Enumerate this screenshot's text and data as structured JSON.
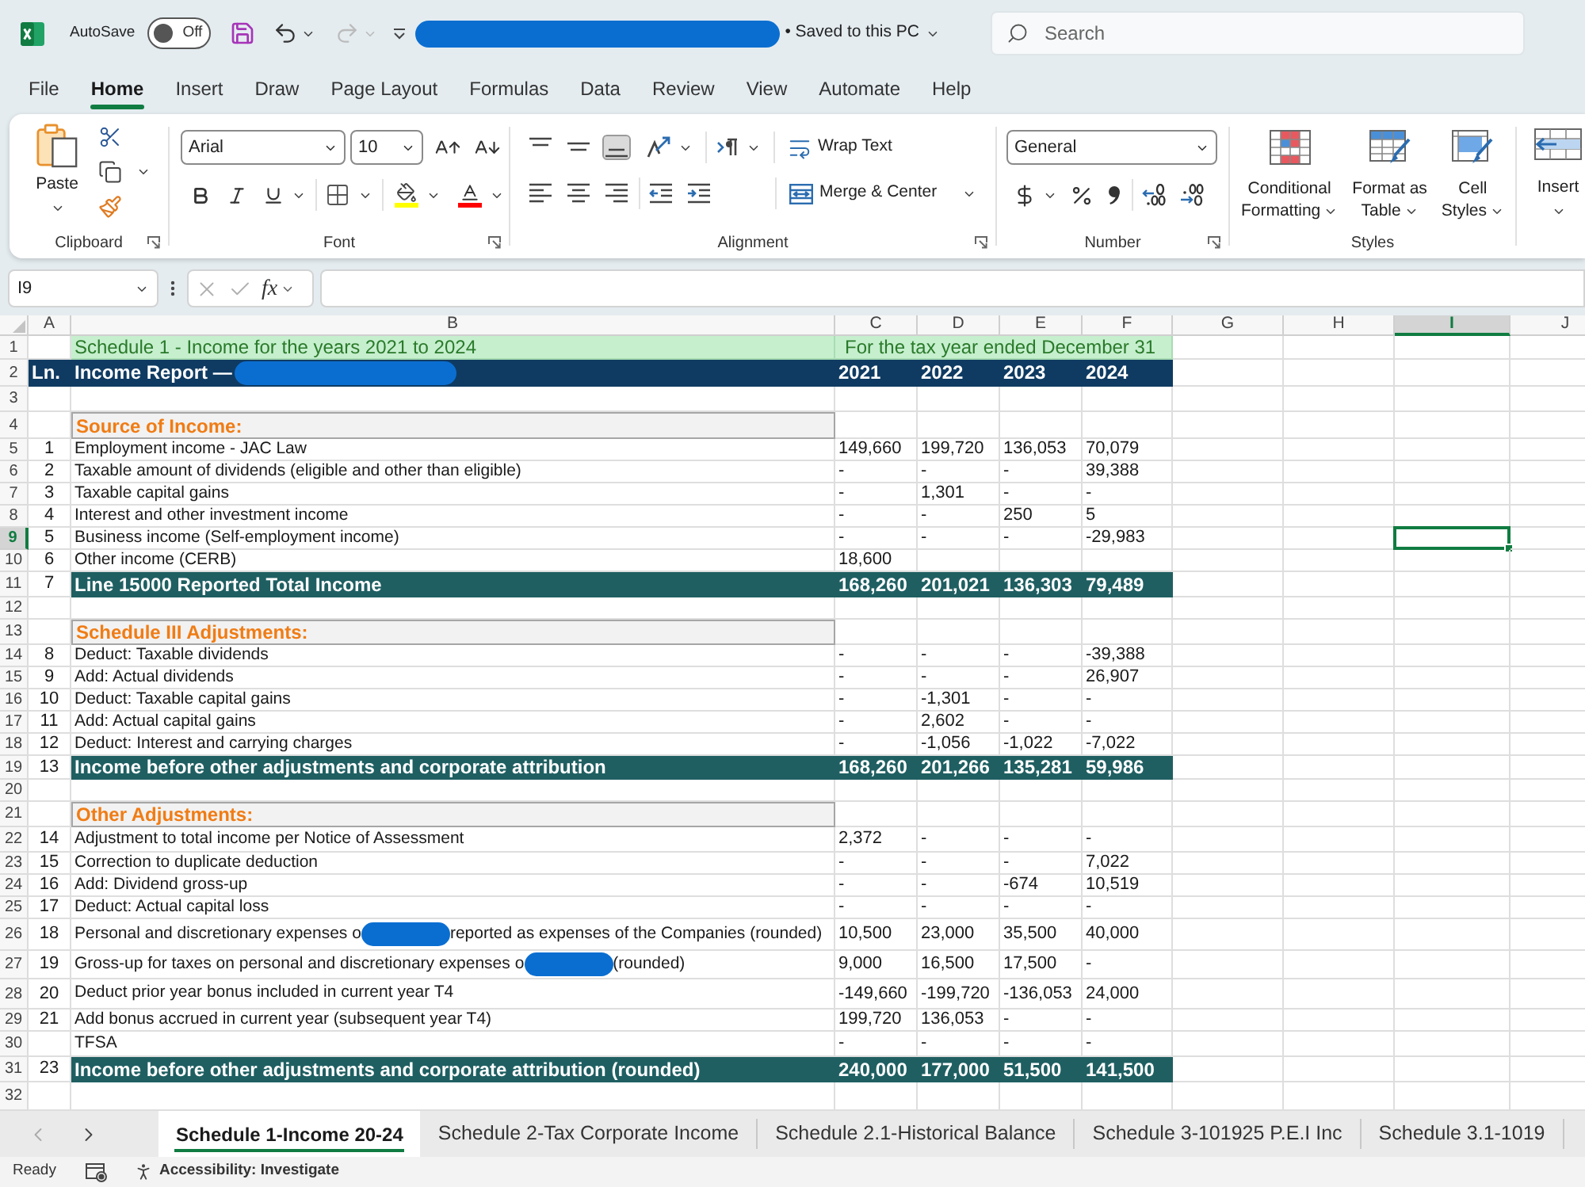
{
  "title_bar": {
    "autosave": {
      "label": "AutoSave",
      "on": false,
      "state_text": "Off"
    },
    "document": [
      {
        "kind": "redaction"
      },
      {
        "kind": "text",
        "text": "• Saved to this PC"
      }
    ],
    "search": {
      "placeholder": "Search"
    }
  },
  "menu": [
    {
      "label": "File",
      "selected": false
    },
    {
      "label": "Home",
      "selected": true
    },
    {
      "label": "Insert",
      "selected": false
    },
    {
      "label": "Draw",
      "selected": false
    },
    {
      "label": "Page Layout",
      "selected": false
    },
    {
      "label": "Formulas",
      "selected": false
    },
    {
      "label": "Data",
      "selected": false
    },
    {
      "label": "Review",
      "selected": false
    },
    {
      "label": "View",
      "selected": false
    },
    {
      "label": "Automate",
      "selected": false
    },
    {
      "label": "Help",
      "selected": false
    }
  ],
  "ribbon": {
    "clipboard": {
      "paste": "Paste",
      "title": "Clipboard"
    },
    "font": {
      "font_name": "Arial",
      "font_size": "10",
      "title": "Font"
    },
    "alignment": {
      "vertical": [
        {
          "kind": "top",
          "selected": false
        },
        {
          "kind": "middle",
          "selected": false
        },
        {
          "kind": "bottom",
          "selected": true
        }
      ],
      "wrap_text": "Wrap Text",
      "merge": "Merge & Center",
      "title": "Alignment"
    },
    "number": {
      "format": "General",
      "title": "Number"
    },
    "styles": {
      "buttons": [
        {
          "kind": "conditional",
          "lines": [
            "Conditional",
            "Formatting"
          ]
        },
        {
          "kind": "table",
          "lines": [
            "Format as",
            "Table"
          ]
        },
        {
          "kind": "cell",
          "lines": [
            "Cell",
            "Styles"
          ]
        }
      ],
      "title": "Styles"
    },
    "cells": {
      "insert": "Insert"
    }
  },
  "formula_bar": {
    "name_box": "I9",
    "function_label": "fx"
  },
  "sheet": {
    "columns": [
      {
        "label": "A",
        "selected": false
      },
      {
        "label": "B",
        "selected": false
      },
      {
        "label": "C",
        "selected": false
      },
      {
        "label": "D",
        "selected": false
      },
      {
        "label": "E",
        "selected": false
      },
      {
        "label": "F",
        "selected": false
      },
      {
        "label": "G",
        "selected": false
      },
      {
        "label": "H",
        "selected": false
      },
      {
        "label": "I",
        "selected": true
      },
      {
        "label": "J",
        "selected": false
      }
    ],
    "rows": [
      {
        "number": "1",
        "selected": false,
        "kind": "title",
        "label": "Schedule 1 - Income for the years 2021 to 2024",
        "period": "For the tax year ended December 31"
      },
      {
        "number": "2",
        "selected": false,
        "kind": "header",
        "line": "Ln.",
        "label_segments": [
          {
            "kind": "text",
            "text": "Income Report —"
          },
          {
            "kind": "redaction"
          }
        ],
        "values": [
          "2021",
          "2022",
          "2023",
          "2024"
        ]
      },
      {
        "number": "3",
        "selected": false,
        "kind": "blank"
      },
      {
        "number": "4",
        "selected": false,
        "kind": "section",
        "label": "Source of Income:"
      },
      {
        "number": "5",
        "selected": false,
        "kind": "item",
        "line": "1",
        "label": "Employment income - JAC Law",
        "values": [
          "149,660",
          "199,720",
          "136,053",
          "70,079"
        ]
      },
      {
        "number": "6",
        "selected": false,
        "kind": "item",
        "line": "2",
        "label": "Taxable amount of dividends (eligible and other than eligible)",
        "values": [
          "-",
          "-",
          "-",
          "39,388"
        ]
      },
      {
        "number": "7",
        "selected": false,
        "kind": "item",
        "line": "3",
        "label": "Taxable capital gains",
        "values": [
          "-",
          "1,301",
          "-",
          "-"
        ]
      },
      {
        "number": "8",
        "selected": false,
        "kind": "item",
        "line": "4",
        "label": "Interest and other investment income",
        "values": [
          "-",
          "-",
          "250",
          "5"
        ]
      },
      {
        "number": "9",
        "selected": true,
        "kind": "item",
        "line": "5",
        "label": "Business income (Self-employment income)",
        "values": [
          "-",
          "-",
          "-",
          "-29,983"
        ]
      },
      {
        "number": "10",
        "selected": false,
        "kind": "item",
        "line": "6",
        "label": "Other income (CERB)",
        "values": [
          "18,600"
        ]
      },
      {
        "number": "11",
        "selected": false,
        "kind": "total",
        "line": "7",
        "label": "Line 15000 Reported Total Income",
        "values": [
          "168,260",
          "201,021",
          "136,303",
          "79,489"
        ]
      },
      {
        "number": "12",
        "selected": false,
        "kind": "blank"
      },
      {
        "number": "13",
        "selected": false,
        "kind": "section",
        "label": "Schedule III Adjustments:"
      },
      {
        "number": "14",
        "selected": false,
        "kind": "item",
        "line": "8",
        "label": "Deduct: Taxable dividends",
        "values": [
          "-",
          "-",
          "-",
          "-39,388"
        ]
      },
      {
        "number": "15",
        "selected": false,
        "kind": "item",
        "line": "9",
        "label": "Add: Actual dividends",
        "values": [
          "-",
          "-",
          "-",
          "26,907"
        ]
      },
      {
        "number": "16",
        "selected": false,
        "kind": "item",
        "line": "10",
        "label": "Deduct: Taxable capital gains",
        "values": [
          "-",
          "-1,301",
          "-",
          "-"
        ]
      },
      {
        "number": "17",
        "selected": false,
        "kind": "item",
        "line": "11",
        "label": "Add: Actual capital gains",
        "values": [
          "-",
          "2,602",
          "-",
          "-"
        ]
      },
      {
        "number": "18",
        "selected": false,
        "kind": "item",
        "line": "12",
        "label": "Deduct: Interest and carrying charges",
        "values": [
          "-",
          "-1,056",
          "-1,022",
          "-7,022"
        ]
      },
      {
        "number": "19",
        "selected": false,
        "kind": "total",
        "line": "13",
        "label": "Income before other adjustments and corporate attribution",
        "values": [
          "168,260",
          "201,266",
          "135,281",
          "59,986"
        ]
      },
      {
        "number": "20",
        "selected": false,
        "kind": "blank"
      },
      {
        "number": "21",
        "selected": false,
        "kind": "section",
        "label": "Other Adjustments:"
      },
      {
        "number": "22",
        "selected": false,
        "kind": "item",
        "line": "14",
        "label": "Adjustment to total income per Notice of Assessment",
        "values": [
          "2,372",
          "-",
          "-",
          "-"
        ]
      },
      {
        "number": "23",
        "selected": false,
        "kind": "item",
        "line": "15",
        "label": "Correction to duplicate deduction",
        "values": [
          "-",
          "-",
          "-",
          "7,022"
        ]
      },
      {
        "number": "24",
        "selected": false,
        "kind": "item",
        "line": "16",
        "label": "Add: Dividend gross-up",
        "values": [
          "-",
          "-",
          "-674",
          "10,519"
        ]
      },
      {
        "number": "25",
        "selected": false,
        "kind": "item",
        "line": "17",
        "label": "Deduct: Actual capital loss",
        "values": [
          "-",
          "-",
          "-",
          "-"
        ]
      },
      {
        "number": "26",
        "selected": false,
        "kind": "item",
        "line": "18",
        "label_segments": [
          {
            "kind": "text",
            "text": "Personal and discretionary expenses o"
          },
          {
            "kind": "redaction"
          },
          {
            "kind": "text",
            "text": "reported as expenses of the Companies (rounded)"
          }
        ],
        "values": [
          "10,500",
          "23,000",
          "35,500",
          "40,000"
        ]
      },
      {
        "number": "27",
        "selected": false,
        "kind": "item",
        "line": "19",
        "label_segments": [
          {
            "kind": "text",
            "text": "Gross-up for taxes on personal and discretionary expenses o"
          },
          {
            "kind": "redaction"
          },
          {
            "kind": "text",
            "text": "(rounded)"
          }
        ],
        "values": [
          "9,000",
          "16,500",
          "17,500",
          "-"
        ]
      },
      {
        "number": "28",
        "selected": false,
        "kind": "item",
        "line": "20",
        "label": "Deduct prior year bonus included in current year T4",
        "values": [
          "-149,660",
          "-199,720",
          "-136,053",
          "24,000"
        ]
      },
      {
        "number": "29",
        "selected": false,
        "kind": "item",
        "line": "21",
        "label": "Add bonus accrued in current year (subsequent year T4)",
        "values": [
          "199,720",
          "136,053",
          "-",
          "-"
        ]
      },
      {
        "number": "30",
        "selected": false,
        "kind": "item",
        "label": "TFSA",
        "values": [
          "-",
          "-",
          "-",
          "-"
        ]
      },
      {
        "number": "31",
        "selected": false,
        "kind": "total",
        "line": "23",
        "label": "Income before other adjustments and corporate attribution (rounded)",
        "values": [
          "240,000",
          "177,000",
          "51,500",
          "141,500"
        ]
      },
      {
        "number": "32",
        "selected": false,
        "kind": "blank"
      }
    ]
  },
  "sheet_tabs": [
    {
      "label": "Schedule 1-Income 20-24",
      "selected": true
    },
    {
      "label": "Schedule 2-Tax Corporate Income",
      "selected": false
    },
    {
      "label": "Schedule 2.1-Historical Balance",
      "selected": false
    },
    {
      "label": "Schedule 3-101925 P.E.I Inc",
      "selected": false
    },
    {
      "label": "Schedule 3.1-1019",
      "selected": false
    }
  ],
  "status_bar": {
    "ready": "Ready",
    "accessibility": "Accessibility: Investigate"
  }
}
